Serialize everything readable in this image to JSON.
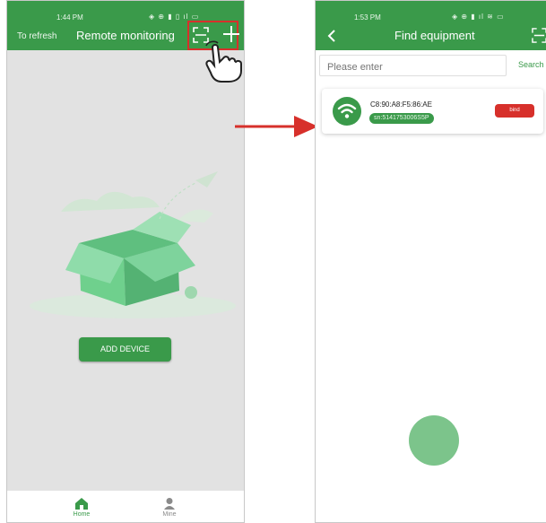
{
  "colors": {
    "brand_green": "#3a9a4a",
    "highlight_red": "#d7302b",
    "bg_gray": "#e2e2e2"
  },
  "left_screen": {
    "status_time": "1:44 PM",
    "refresh_label": "To refresh",
    "title": "Remote monitoring",
    "add_device_label": "ADD DEVICE",
    "nav": {
      "home_label": "Home",
      "mine_label": "Mine"
    },
    "icons": [
      "scan-icon",
      "plus-icon",
      "pointing-hand-icon",
      "empty-box-illustration",
      "home-icon",
      "person-icon"
    ]
  },
  "right_screen": {
    "status_time": "1:53 PM",
    "title": "Find equipment",
    "search_placeholder": "Please enter",
    "search_label": "Search",
    "device": {
      "mac": "C8:90:A8:F5:86:AE",
      "sn": "sn:5141753006S5P",
      "bind_label": "bind"
    },
    "icons": [
      "back-icon",
      "scan-icon",
      "wifi-icon"
    ]
  }
}
